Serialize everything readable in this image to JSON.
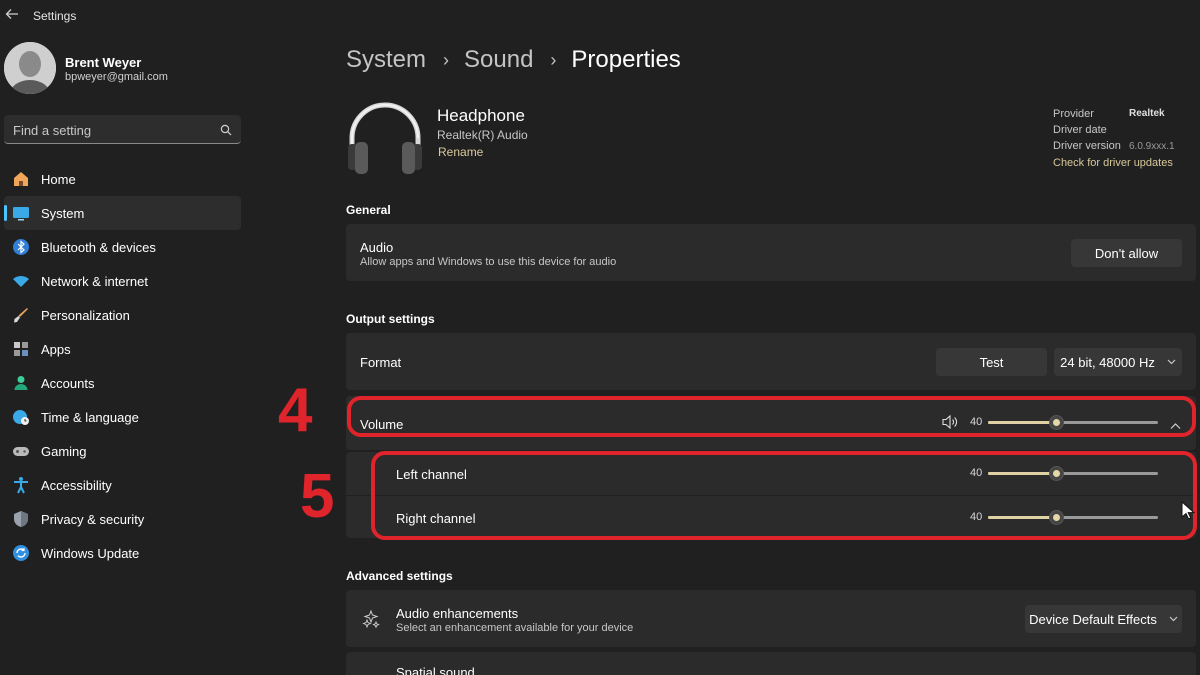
{
  "window": {
    "title": "Settings",
    "back_icon": "back-arrow-icon"
  },
  "profile": {
    "name": "Brent Weyer",
    "email": "bpweyer@gmail.com"
  },
  "search": {
    "placeholder": "Find a setting",
    "icon": "search-icon"
  },
  "nav": {
    "items": [
      {
        "label": "Home",
        "icon": "home-icon",
        "selected": false
      },
      {
        "label": "System",
        "icon": "system-icon",
        "selected": true
      },
      {
        "label": "Bluetooth & devices",
        "icon": "bluetooth-icon",
        "selected": false
      },
      {
        "label": "Network & internet",
        "icon": "wifi-icon",
        "selected": false
      },
      {
        "label": "Personalization",
        "icon": "brush-icon",
        "selected": false
      },
      {
        "label": "Apps",
        "icon": "apps-icon",
        "selected": false
      },
      {
        "label": "Accounts",
        "icon": "person-icon",
        "selected": false
      },
      {
        "label": "Time & language",
        "icon": "globe-clock-icon",
        "selected": false
      },
      {
        "label": "Gaming",
        "icon": "gamepad-icon",
        "selected": false
      },
      {
        "label": "Accessibility",
        "icon": "accessibility-icon",
        "selected": false
      },
      {
        "label": "Privacy & security",
        "icon": "shield-icon",
        "selected": false
      },
      {
        "label": "Windows Update",
        "icon": "update-icon",
        "selected": false
      }
    ]
  },
  "breadcrumb": {
    "level1": "System",
    "level2": "Sound",
    "current": "Properties",
    "separator": "›"
  },
  "device": {
    "name": "Headphone",
    "subtitle": "Realtek(R) Audio",
    "rename_label": "Rename",
    "icon": "headphone-icon"
  },
  "driver_info": {
    "provider_label": "Provider",
    "provider_value": "Realtek",
    "date_label": "Driver date",
    "version_label": "Driver version",
    "version_value": "6.0.9xxx.1",
    "update_link": "Check for driver updates"
  },
  "general": {
    "title": "General",
    "audio_title": "Audio",
    "audio_sub": "Allow apps and Windows to use this device for audio",
    "audio_button": "Don't allow"
  },
  "output": {
    "title": "Output settings",
    "format_label": "Format",
    "test_button": "Test",
    "format_value": "24 bit, 48000 Hz",
    "volume_label": "Volume",
    "volume_value": 40,
    "volume_text": "40",
    "left_label": "Left channel",
    "left_value": 40,
    "left_text": "40",
    "right_label": "Right channel",
    "right_value": 40,
    "right_text": "40"
  },
  "advanced": {
    "title": "Advanced settings",
    "enh_title": "Audio enhancements",
    "enh_sub": "Select an enhancement available for your device",
    "enh_value": "Device Default Effects",
    "spatial_title": "Spatial sound"
  },
  "annotations": {
    "four": "4",
    "five": "5",
    "color": "#e0242b"
  },
  "colors": {
    "accent": "#4cc2ff",
    "slider": "#e0d2a4",
    "link": "#d8c89a",
    "background": "#202020",
    "card": "#2b2b2b"
  }
}
